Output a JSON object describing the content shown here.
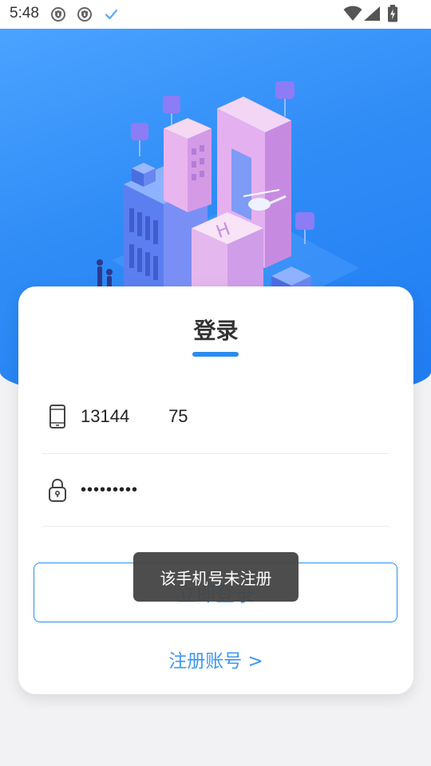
{
  "status_bar": {
    "time": "5:48",
    "left_icons": [
      "shield-icon",
      "shield-icon",
      "check-icon"
    ],
    "right_icons": [
      "wifi-icon",
      "signal-icon",
      "battery-charging-icon"
    ]
  },
  "hero": {
    "illustration": "isometric-city-illustration"
  },
  "login": {
    "title": "登录",
    "phone": {
      "icon": "phone-icon",
      "value": "13144        75"
    },
    "password": {
      "icon": "lock-icon",
      "masked_value": "•••••••••"
    },
    "submit_label": "立即登录",
    "register_label": "注册账号 >"
  },
  "toast": {
    "message": "该手机号未注册"
  },
  "colors": {
    "accent": "#2a8cf0",
    "hero_top": "#4aa3ff",
    "hero_bottom": "#1f7cf2",
    "toast_bg": "#464646",
    "page_bg": "#f2f2f4"
  }
}
